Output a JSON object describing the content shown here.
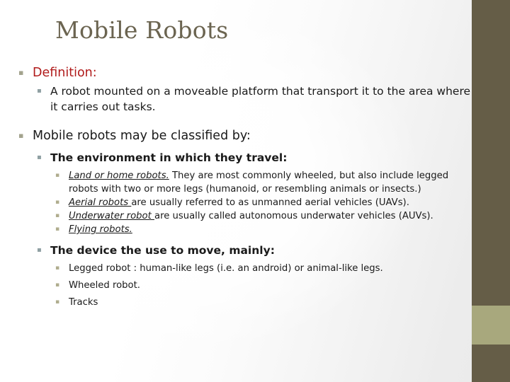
{
  "slide": {
    "title": "Mobile Robots",
    "theme": {
      "title_color": "#6b6450",
      "accent_dark": "#655d47",
      "accent_light": "#a8a87d",
      "highlight_color": "#b01a1a",
      "body_color": "#1a1a1a",
      "background": "#ffffff"
    },
    "bullet_glyph": "▪"
  },
  "content": {
    "definition_heading": "Definition:",
    "definition_text": "A robot mounted on a moveable platform that transport it to the area where it carries out tasks.",
    "classified_heading": "Mobile robots may be classified by:",
    "categories": [
      {
        "heading": "The environment in which they travel:",
        "items": [
          {
            "lead": "Land or home robots.",
            "rest": " They are most commonly wheeled, but also include legged robots with two or more legs (humanoid, or resembling animals or insects.)"
          },
          {
            "lead": "Aerial robots ",
            "rest": "are usually referred to as unmanned aerial vehicles (UAVs)."
          },
          {
            "lead": "Underwater robot ",
            "rest": "are usually called autonomous underwater vehicles (AUVs)."
          },
          {
            "lead": "Flying robots.",
            "rest": ""
          }
        ]
      },
      {
        "heading": "The device the use to move, mainly:",
        "items": [
          {
            "lead": "",
            "rest": "Legged robot : human-like legs (i.e. an android) or animal-like legs."
          },
          {
            "lead": "",
            "rest": "Wheeled robot."
          },
          {
            "lead": "",
            "rest": "Tracks"
          }
        ]
      }
    ]
  }
}
